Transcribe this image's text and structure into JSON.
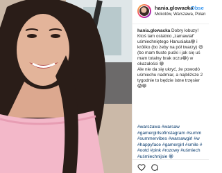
{
  "post": {
    "username": "hania.glowacka",
    "separator": "•",
    "follow_label": "Obse",
    "location": "Mokotów, Warszawa, Polan",
    "caption_lines": [
      {
        "user": "hania.glowacka",
        "text": " Dobry łobuzy!"
      },
      {
        "text": "Ktoś tam ostatnio „zamawiał”"
      },
      {
        "text": "uśmiechniętego Hanusiaka😁 i"
      },
      {
        "text": "króliko (bo żeby na pół twarzy) 😃"
      },
      {
        "text": "(bo mam tłuste pućki i jak się uś"
      },
      {
        "text": "mam totalny brak oczu😂) w"
      },
      {
        "text": "okazałości 😁"
      },
      {
        "text": "Ale nie da się ukryć, że powodó"
      },
      {
        "text": "uśmiechu nadmiar, a najbliższe 2"
      },
      {
        "text": "tygodnie to będzie istne trzęsier"
      },
      {
        "text": "😱😁"
      }
    ],
    "hashtag_lines": [
      "#warszawa #warsaw",
      "#gamergirlsofinstagram #summ",
      "#summervibes #warsawgirl #w",
      "#happyface #gamergirl #smile #",
      "#ootd #pink #rozowy #uśmiech",
      "#uśmiechnijsie 😁"
    ]
  },
  "actions": {
    "like_icon": "heart-icon",
    "comment_icon": "comment-icon"
  },
  "photo": {
    "description_icon": "selfie-photo"
  }
}
